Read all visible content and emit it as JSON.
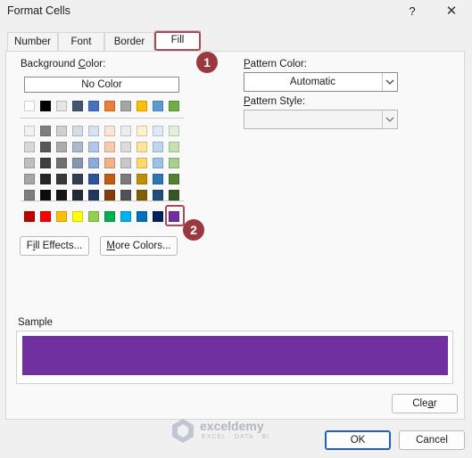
{
  "window": {
    "title": "Format Cells",
    "help_glyph": "?",
    "close_glyph": "✕"
  },
  "tabs": [
    {
      "label": "Number"
    },
    {
      "label": "Font"
    },
    {
      "label": "Border"
    },
    {
      "label": "Fill",
      "active": true
    }
  ],
  "fill": {
    "background_color_label": "Background Color:",
    "no_color_label": "No Color",
    "pattern_color_label": "Pattern Color:",
    "pattern_color_value": "Automatic",
    "pattern_style_label": "Pattern Style:",
    "pattern_style_value": "",
    "fill_effects_label": "Fill Effects...",
    "more_colors_label": "More Colors...",
    "sample_label": "Sample",
    "sample_color": "#7030a0",
    "selected_color": "#7030a0"
  },
  "palette": {
    "theme_row": [
      "#ffffff",
      "#000000",
      "#e7e6e6",
      "#44546a",
      "#4472c4",
      "#ed7d31",
      "#a5a5a5",
      "#ffc000",
      "#5b9bd5",
      "#70ad47"
    ],
    "tint_rows": [
      [
        "#f2f2f2",
        "#7f7f7f",
        "#d0cece",
        "#d6dce4",
        "#d9e2f3",
        "#fbe5d5",
        "#ededed",
        "#fff2cc",
        "#deebf6",
        "#e2efd9"
      ],
      [
        "#d8d8d8",
        "#595959",
        "#aeabab",
        "#adb9ca",
        "#b4c6e7",
        "#f7cbac",
        "#dbdbdb",
        "#fee599",
        "#bdd7ee",
        "#c5e0b3"
      ],
      [
        "#bfbfbf",
        "#3f3f3f",
        "#757070",
        "#8496b0",
        "#8eaadb",
        "#f4b183",
        "#c9c9c9",
        "#ffd965",
        "#9cc3e5",
        "#a8d08d"
      ],
      [
        "#a5a5a5",
        "#262626",
        "#3a3838",
        "#323f4f",
        "#2f5496",
        "#c55a11",
        "#7b7b7b",
        "#bf9000",
        "#2e75b5",
        "#538135"
      ],
      [
        "#7f7f7f",
        "#0c0c0c",
        "#171616",
        "#222a35",
        "#1f3864",
        "#833c0b",
        "#525252",
        "#7f6000",
        "#1e4e79",
        "#375623"
      ]
    ],
    "standard_row": [
      "#c00000",
      "#ff0000",
      "#ffc000",
      "#ffff00",
      "#92d050",
      "#00b050",
      "#00b0f0",
      "#0070c0",
      "#002060",
      "#7030a0"
    ]
  },
  "callouts": [
    {
      "number": "1"
    },
    {
      "number": "2"
    }
  ],
  "buttons": {
    "clear_label": "Clear",
    "ok_label": "OK",
    "cancel_label": "Cancel"
  },
  "watermark": {
    "brand": "exceldemy",
    "tagline": "EXCEL · DATA · BI"
  }
}
